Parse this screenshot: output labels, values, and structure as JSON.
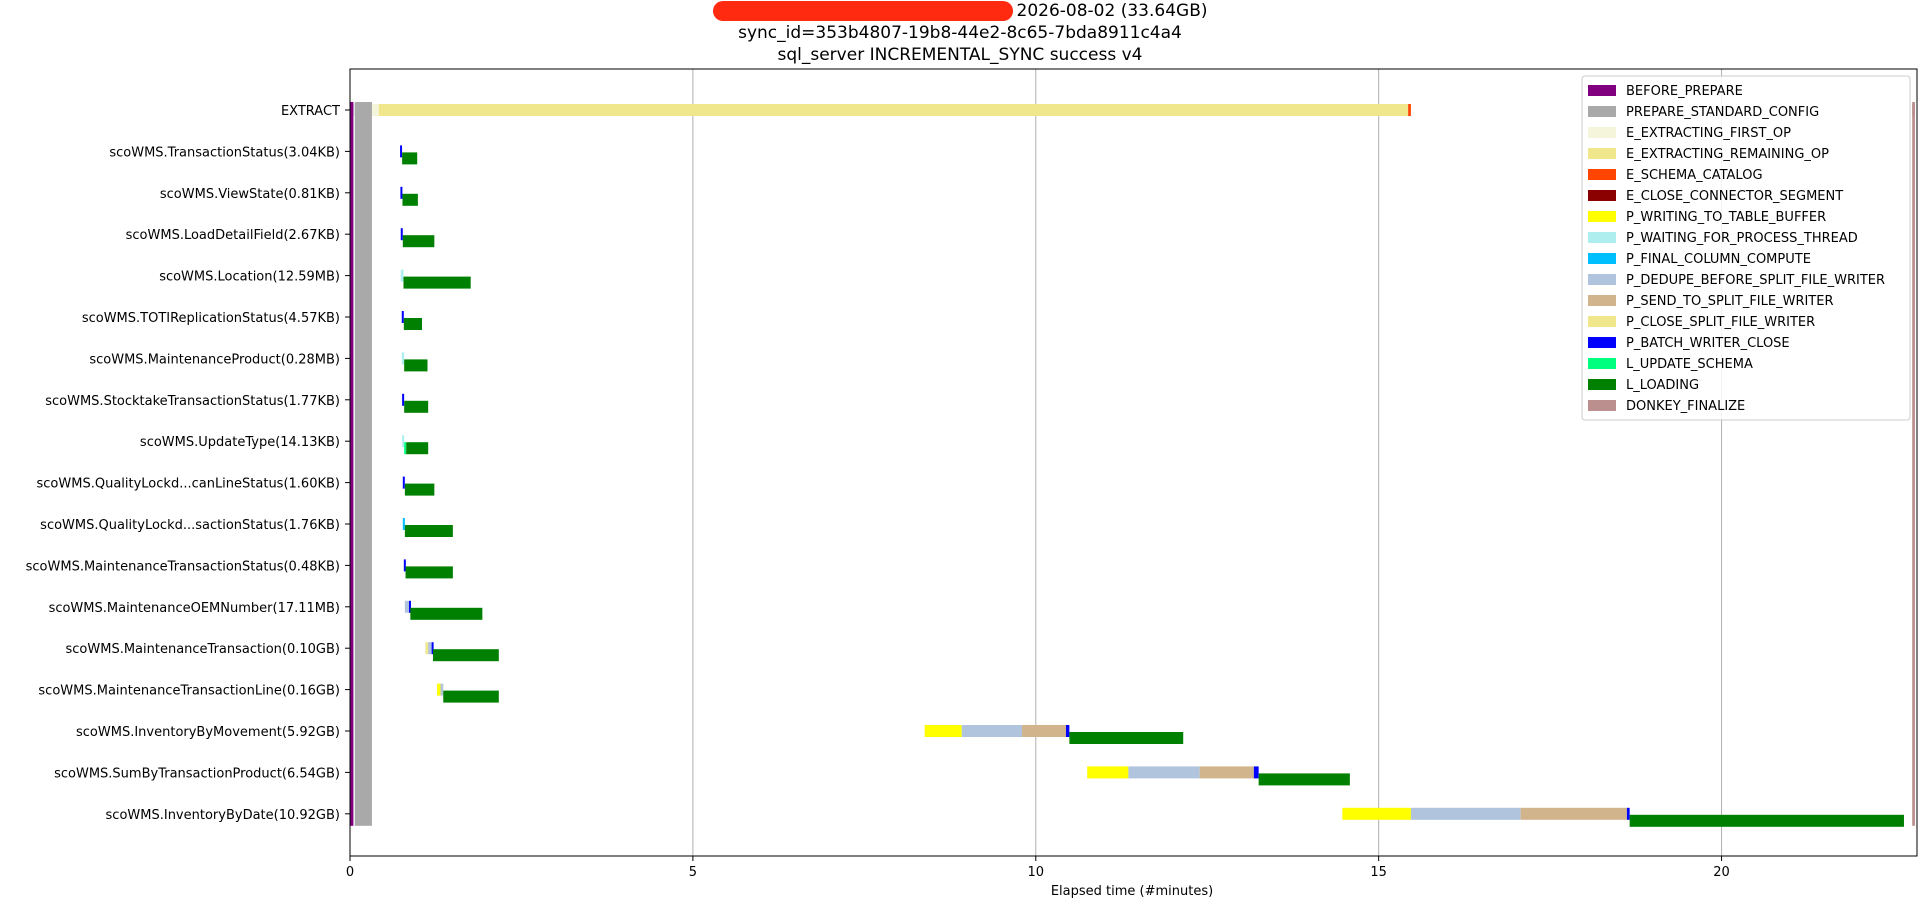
{
  "header": {
    "title_line1": "2026-08-02 (33.64GB)",
    "title_line2": "sync_id=353b4807-19b8-44e2-8c65-7bda8911c4a4",
    "title_line3": "sql_server  INCREMENTAL_SYNC  success  v4"
  },
  "chart_data": {
    "type": "bar",
    "orientation": "horizontal-gantt",
    "xlabel": "Elapsed time (#minutes)",
    "ylabel": "",
    "xlim": [
      0,
      22.85
    ],
    "xticks": [
      0,
      5,
      10,
      15,
      20
    ],
    "grid": "vertical",
    "legend_placement": "top-right",
    "categories": [
      "EXTRACT",
      "scoWMS.TransactionStatus(3.04KB)",
      "scoWMS.ViewState(0.81KB)",
      "scoWMS.LoadDetailField(2.67KB)",
      "scoWMS.Location(12.59MB)",
      "scoWMS.TOTIReplicationStatus(4.57KB)",
      "scoWMS.MaintenanceProduct(0.28MB)",
      "scoWMS.StocktakeTransactionStatus(1.77KB)",
      "scoWMS.UpdateType(14.13KB)",
      "scoWMS.QualityLockd...canLineStatus(1.60KB)",
      "scoWMS.QualityLockd...sactionStatus(1.76KB)",
      "scoWMS.MaintenanceTransactionStatus(0.48KB)",
      "scoWMS.MaintenanceOEMNumber(17.11MB)",
      "scoWMS.MaintenanceTransaction(0.10GB)",
      "scoWMS.MaintenanceTransactionLine(0.16GB)",
      "scoWMS.InventoryByMovement(5.92GB)",
      "scoWMS.SumByTransactionProduct(6.54GB)",
      "scoWMS.InventoryByDate(10.92GB)"
    ],
    "stages": [
      {
        "name": "BEFORE_PREPARE",
        "color": "#800080"
      },
      {
        "name": "PREPARE_STANDARD_CONFIG",
        "color": "#a9a9a9"
      },
      {
        "name": "E_EXTRACTING_FIRST_OP",
        "color": "#f5f5dc"
      },
      {
        "name": "E_EXTRACTING_REMAINING_OP",
        "color": "#f0e68c"
      },
      {
        "name": "E_SCHEMA_CATALOG",
        "color": "#ff4500"
      },
      {
        "name": "E_CLOSE_CONNECTOR_SEGMENT",
        "color": "#8b0000"
      },
      {
        "name": "P_WRITING_TO_TABLE_BUFFER",
        "color": "#ffff00"
      },
      {
        "name": "P_WAITING_FOR_PROCESS_THREAD",
        "color": "#afeeee"
      },
      {
        "name": "P_FINAL_COLUMN_COMPUTE",
        "color": "#00bfff"
      },
      {
        "name": "P_DEDUPE_BEFORE_SPLIT_FILE_WRITER",
        "color": "#b0c4de"
      },
      {
        "name": "P_SEND_TO_SPLIT_FILE_WRITER",
        "color": "#d2b48c"
      },
      {
        "name": "P_CLOSE_SPLIT_FILE_WRITER",
        "color": "#f0e68c"
      },
      {
        "name": "P_BATCH_WRITER_CLOSE",
        "color": "#0000ff"
      },
      {
        "name": "L_UPDATE_SCHEMA",
        "color": "#00ff7f"
      },
      {
        "name": "L_LOADING",
        "color": "#008000"
      },
      {
        "name": "DONKEY_FINALIZE",
        "color": "#bc8f8f"
      }
    ],
    "segments": [
      {
        "row": 0,
        "stage": "BEFORE_PREPARE",
        "start": 0.0,
        "end": 0.05,
        "offset": 0
      },
      {
        "row": 0,
        "stage": "PREPARE_STANDARD_CONFIG",
        "start": 0.07,
        "end": 0.32,
        "offset": 0
      },
      {
        "row": 0,
        "stage": "E_EXTRACTING_FIRST_OP",
        "start": 0.32,
        "end": 0.42,
        "offset": 0
      },
      {
        "row": 0,
        "stage": "E_EXTRACTING_REMAINING_OP",
        "start": 0.42,
        "end": 15.43,
        "offset": 0
      },
      {
        "row": 0,
        "stage": "E_SCHEMA_CATALOG",
        "start": 15.43,
        "end": 15.47,
        "offset": 0
      },
      {
        "row": 0,
        "stage": "DONKEY_FINALIZE",
        "start": 22.78,
        "end": 22.82,
        "offset": 0
      },
      {
        "row": 1,
        "stage": "P_BATCH_WRITER_CLOSE",
        "start": 0.73,
        "end": 0.755,
        "offset": 0
      },
      {
        "row": 1,
        "stage": "L_LOADING",
        "start": 0.76,
        "end": 0.98,
        "offset": 1
      },
      {
        "row": 2,
        "stage": "P_BATCH_WRITER_CLOSE",
        "start": 0.735,
        "end": 0.76,
        "offset": 0
      },
      {
        "row": 2,
        "stage": "L_LOADING",
        "start": 0.765,
        "end": 0.99,
        "offset": 1
      },
      {
        "row": 3,
        "stage": "P_BATCH_WRITER_CLOSE",
        "start": 0.74,
        "end": 0.765,
        "offset": 0
      },
      {
        "row": 3,
        "stage": "L_LOADING",
        "start": 0.77,
        "end": 1.23,
        "offset": 1
      },
      {
        "row": 4,
        "stage": "P_WAITING_FOR_PROCESS_THREAD",
        "start": 0.74,
        "end": 0.78,
        "offset": 0
      },
      {
        "row": 4,
        "stage": "L_LOADING",
        "start": 0.78,
        "end": 1.76,
        "offset": 1
      },
      {
        "row": 5,
        "stage": "P_BATCH_WRITER_CLOSE",
        "start": 0.755,
        "end": 0.78,
        "offset": 0
      },
      {
        "row": 5,
        "stage": "L_LOADING",
        "start": 0.785,
        "end": 1.05,
        "offset": 1
      },
      {
        "row": 6,
        "stage": "P_WAITING_FOR_PROCESS_THREAD",
        "start": 0.755,
        "end": 0.79,
        "offset": 0
      },
      {
        "row": 6,
        "stage": "L_LOADING",
        "start": 0.79,
        "end": 1.13,
        "offset": 1
      },
      {
        "row": 7,
        "stage": "P_BATCH_WRITER_CLOSE",
        "start": 0.76,
        "end": 0.785,
        "offset": 0
      },
      {
        "row": 7,
        "stage": "L_LOADING",
        "start": 0.79,
        "end": 1.14,
        "offset": 1
      },
      {
        "row": 8,
        "stage": "P_WAITING_FOR_PROCESS_THREAD",
        "start": 0.76,
        "end": 0.79,
        "offset": 0
      },
      {
        "row": 8,
        "stage": "L_UPDATE_SCHEMA",
        "start": 0.79,
        "end": 0.82,
        "offset": 1
      },
      {
        "row": 8,
        "stage": "L_LOADING",
        "start": 0.82,
        "end": 1.14,
        "offset": 1
      },
      {
        "row": 9,
        "stage": "P_BATCH_WRITER_CLOSE",
        "start": 0.77,
        "end": 0.795,
        "offset": 0
      },
      {
        "row": 9,
        "stage": "L_LOADING",
        "start": 0.8,
        "end": 1.23,
        "offset": 1
      },
      {
        "row": 10,
        "stage": "P_FINAL_COLUMN_COMPUTE",
        "start": 0.77,
        "end": 0.8,
        "offset": 0
      },
      {
        "row": 10,
        "stage": "L_LOADING",
        "start": 0.8,
        "end": 1.5,
        "offset": 1
      },
      {
        "row": 11,
        "stage": "P_BATCH_WRITER_CLOSE",
        "start": 0.785,
        "end": 0.81,
        "offset": 0
      },
      {
        "row": 11,
        "stage": "L_LOADING",
        "start": 0.81,
        "end": 1.5,
        "offset": 1
      },
      {
        "row": 12,
        "stage": "P_DEDUPE_BEFORE_SPLIT_FILE_WRITER",
        "start": 0.8,
        "end": 0.86,
        "offset": 0
      },
      {
        "row": 12,
        "stage": "P_BATCH_WRITER_CLOSE",
        "start": 0.86,
        "end": 0.88,
        "offset": 0
      },
      {
        "row": 12,
        "stage": "L_LOADING",
        "start": 0.88,
        "end": 1.93,
        "offset": 1
      },
      {
        "row": 13,
        "stage": "E_EXTRACTING_REMAINING_OP",
        "start": 1.1,
        "end": 1.14,
        "offset": 0
      },
      {
        "row": 13,
        "stage": "P_DEDUPE_BEFORE_SPLIT_FILE_WRITER",
        "start": 1.14,
        "end": 1.19,
        "offset": 0
      },
      {
        "row": 13,
        "stage": "P_BATCH_WRITER_CLOSE",
        "start": 1.19,
        "end": 1.21,
        "offset": 0
      },
      {
        "row": 13,
        "stage": "L_LOADING",
        "start": 1.21,
        "end": 2.17,
        "offset": 1
      },
      {
        "row": 14,
        "stage": "P_WRITING_TO_TABLE_BUFFER",
        "start": 1.27,
        "end": 1.32,
        "offset": 0
      },
      {
        "row": 14,
        "stage": "P_DEDUPE_BEFORE_SPLIT_FILE_WRITER",
        "start": 1.32,
        "end": 1.36,
        "offset": 0
      },
      {
        "row": 14,
        "stage": "L_LOADING",
        "start": 1.36,
        "end": 2.17,
        "offset": 1
      },
      {
        "row": 15,
        "stage": "P_WRITING_TO_TABLE_BUFFER",
        "start": 8.38,
        "end": 8.92,
        "offset": 0
      },
      {
        "row": 15,
        "stage": "P_DEDUPE_BEFORE_SPLIT_FILE_WRITER",
        "start": 8.92,
        "end": 9.8,
        "offset": 0
      },
      {
        "row": 15,
        "stage": "P_SEND_TO_SPLIT_FILE_WRITER",
        "start": 9.8,
        "end": 10.44,
        "offset": 0
      },
      {
        "row": 15,
        "stage": "P_BATCH_WRITER_CLOSE",
        "start": 10.44,
        "end": 10.49,
        "offset": 0
      },
      {
        "row": 15,
        "stage": "L_LOADING",
        "start": 10.49,
        "end": 12.15,
        "offset": 1
      },
      {
        "row": 16,
        "stage": "P_WRITING_TO_TABLE_BUFFER",
        "start": 10.75,
        "end": 11.35,
        "offset": 0
      },
      {
        "row": 16,
        "stage": "P_DEDUPE_BEFORE_SPLIT_FILE_WRITER",
        "start": 11.35,
        "end": 12.39,
        "offset": 0
      },
      {
        "row": 16,
        "stage": "P_SEND_TO_SPLIT_FILE_WRITER",
        "start": 12.39,
        "end": 13.18,
        "offset": 0
      },
      {
        "row": 16,
        "stage": "P_BATCH_WRITER_CLOSE",
        "start": 13.18,
        "end": 13.25,
        "offset": 0
      },
      {
        "row": 16,
        "stage": "L_LOADING",
        "start": 13.25,
        "end": 14.58,
        "offset": 1
      },
      {
        "row": 17,
        "stage": "P_WRITING_TO_TABLE_BUFFER",
        "start": 14.47,
        "end": 15.47,
        "offset": 0
      },
      {
        "row": 17,
        "stage": "P_DEDUPE_BEFORE_SPLIT_FILE_WRITER",
        "start": 15.47,
        "end": 17.07,
        "offset": 0
      },
      {
        "row": 17,
        "stage": "P_SEND_TO_SPLIT_FILE_WRITER",
        "start": 17.07,
        "end": 18.62,
        "offset": 0
      },
      {
        "row": 17,
        "stage": "P_BATCH_WRITER_CLOSE",
        "start": 18.62,
        "end": 18.66,
        "offset": 0
      },
      {
        "row": 17,
        "stage": "L_LOADING",
        "start": 18.66,
        "end": 22.66,
        "offset": 1
      }
    ],
    "config_span": {
      "rows": [
        0,
        17
      ],
      "before_prepare": [
        0.0,
        0.05
      ],
      "prepare_standard_config": [
        0.07,
        0.32
      ],
      "donkey_finalize": [
        22.78,
        22.82
      ]
    }
  }
}
